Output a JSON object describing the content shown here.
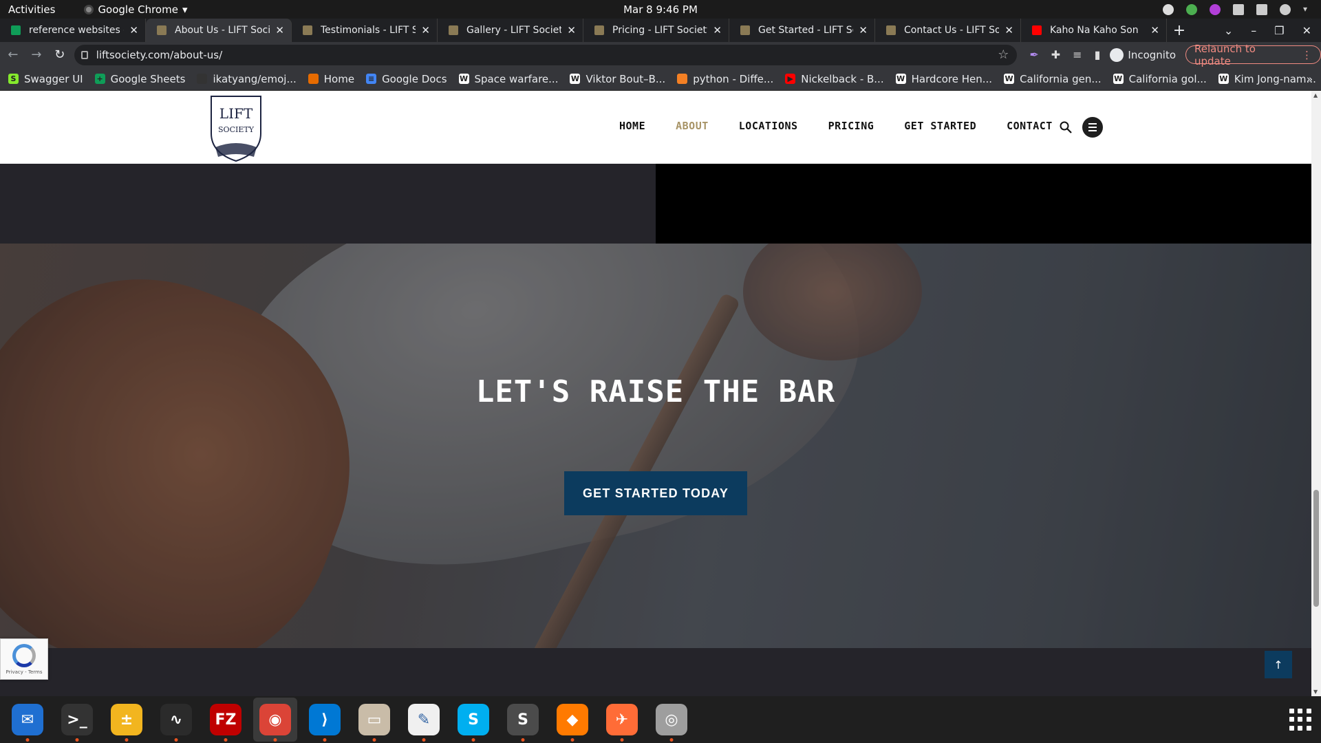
{
  "system": {
    "activities": "Activities",
    "app_name": "Google Chrome",
    "clock": "Mar 8  9:46 PM"
  },
  "tabs": [
    {
      "title": "reference websites - G",
      "favicon_color": "#0f9d58"
    },
    {
      "title": "About Us - LIFT Societ",
      "favicon_color": "#8a7a55"
    },
    {
      "title": "Testimonials - LIFT So",
      "favicon_color": "#8a7a55"
    },
    {
      "title": "Gallery - LIFT Society",
      "favicon_color": "#8a7a55"
    },
    {
      "title": "Pricing - LIFT Society",
      "favicon_color": "#8a7a55"
    },
    {
      "title": "Get Started - LIFT Soci",
      "favicon_color": "#8a7a55"
    },
    {
      "title": "Contact Us - LIFT Soci",
      "favicon_color": "#8a7a55"
    },
    {
      "title": "Kaho Na Kaho Son",
      "favicon_color": "#ff0000"
    }
  ],
  "browser": {
    "url": "liftsociety.com/about-us/",
    "profile": "Incognito",
    "relaunch_label": "Relaunch to update"
  },
  "bookmarks": [
    {
      "label": "Swagger UI",
      "icon": "S",
      "color": "#85ea2d"
    },
    {
      "label": "Google Sheets",
      "icon": "+",
      "color": "#0f9d58"
    },
    {
      "label": "ikatyang/emoj...",
      "icon": "",
      "color": "#333333"
    },
    {
      "label": "Home",
      "icon": "",
      "color": "#e66b00"
    },
    {
      "label": "Google Docs",
      "icon": "≡",
      "color": "#4285f4"
    },
    {
      "label": "Space warfare...",
      "icon": "W",
      "color": "#ffffff"
    },
    {
      "label": "Viktor Bout–B...",
      "icon": "W",
      "color": "#ffffff"
    },
    {
      "label": "python - Diffe...",
      "icon": "",
      "color": "#f48024"
    },
    {
      "label": "Nickelback - B...",
      "icon": "▶",
      "color": "#ff0000"
    },
    {
      "label": "Hardcore Hen...",
      "icon": "W",
      "color": "#ffffff"
    },
    {
      "label": "California gen...",
      "icon": "W",
      "color": "#ffffff"
    },
    {
      "label": "California gol...",
      "icon": "W",
      "color": "#ffffff"
    },
    {
      "label": "Kim Jong-nam...",
      "icon": "W",
      "color": "#ffffff"
    }
  ],
  "site": {
    "logo_top": "LIFT",
    "logo_bottom": "SOCIETY",
    "nav": [
      {
        "label": "HOME",
        "active": false
      },
      {
        "label": "ABOUT",
        "active": true
      },
      {
        "label": "LOCATIONS",
        "active": false
      },
      {
        "label": "PRICING",
        "active": false
      },
      {
        "label": "GET STARTED",
        "active": false
      },
      {
        "label": "CONTACT",
        "active": false
      }
    ],
    "hero_heading": "LET'S RAISE THE BAR",
    "cta_label": "GET STARTED TODAY",
    "recaptcha_text": "Privacy - Terms",
    "accent_color": "#a89467",
    "button_color": "#0c3b5e"
  },
  "dock": [
    {
      "name": "thunderbird",
      "color": "#1f6fd1",
      "glyph": "✉",
      "active": false
    },
    {
      "name": "terminal",
      "color": "#333333",
      "glyph": ">_",
      "active": false
    },
    {
      "name": "calculator",
      "color": "#f2b51f",
      "glyph": "±",
      "active": false
    },
    {
      "name": "system-monitor",
      "color": "#2b2b2b",
      "glyph": "∿",
      "active": false
    },
    {
      "name": "filezilla",
      "color": "#bf0000",
      "glyph": "FZ",
      "active": false
    },
    {
      "name": "chrome",
      "color": "#db4437",
      "glyph": "◉",
      "active": true
    },
    {
      "name": "vscode",
      "color": "#0078d4",
      "glyph": "⟩",
      "active": false
    },
    {
      "name": "files",
      "color": "#c9bca8",
      "glyph": "▭",
      "active": false
    },
    {
      "name": "text-editor",
      "color": "#f0f0f0",
      "glyph": "✎",
      "active": false
    },
    {
      "name": "skype",
      "color": "#00aff0",
      "glyph": "S",
      "active": false
    },
    {
      "name": "sublime-text",
      "color": "#4b4b4b",
      "glyph": "S",
      "active": false
    },
    {
      "name": "postman-fire",
      "color": "#ff7a00",
      "glyph": "◆",
      "active": false
    },
    {
      "name": "postman",
      "color": "#ff6c37",
      "glyph": "✈",
      "active": false
    },
    {
      "name": "disks",
      "color": "#9e9e9e",
      "glyph": "◎",
      "active": false
    }
  ]
}
